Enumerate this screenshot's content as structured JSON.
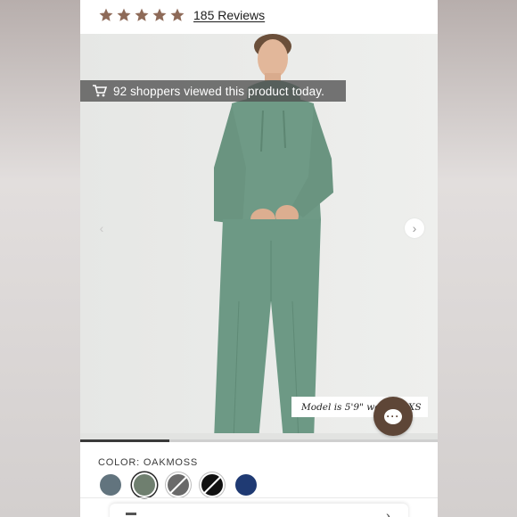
{
  "rating": {
    "stars": 5,
    "star_color": "#8e6a58",
    "reviews_label": "185 Reviews"
  },
  "gallery": {
    "viewer_banner": "92 shoppers viewed this product today.",
    "banner_icon": "shopping-cart-icon",
    "model_note": "Model is 5'9\" wearing XS",
    "prev_arrow": "‹",
    "next_arrow": "›",
    "slide_progress": 0.25
  },
  "chat": {
    "icon": "chat-bubble-icon",
    "glyph": "···",
    "color": "#5e4637"
  },
  "color_selector": {
    "label": "COLOR: OAKMOSS",
    "swatches": [
      {
        "name": "slate-blue",
        "color": "#62747e",
        "selected": false
      },
      {
        "name": "oakmoss",
        "color": "#6f7f6f",
        "selected": true
      },
      {
        "name": "heather-charcoal",
        "color": "#6a6a6a",
        "selected": false,
        "slashed": true
      },
      {
        "name": "black",
        "color": "#111111",
        "selected": false,
        "slashed": true
      },
      {
        "name": "navy",
        "color": "#1f3a73",
        "selected": false
      }
    ]
  },
  "product_color": "#6f9a86"
}
